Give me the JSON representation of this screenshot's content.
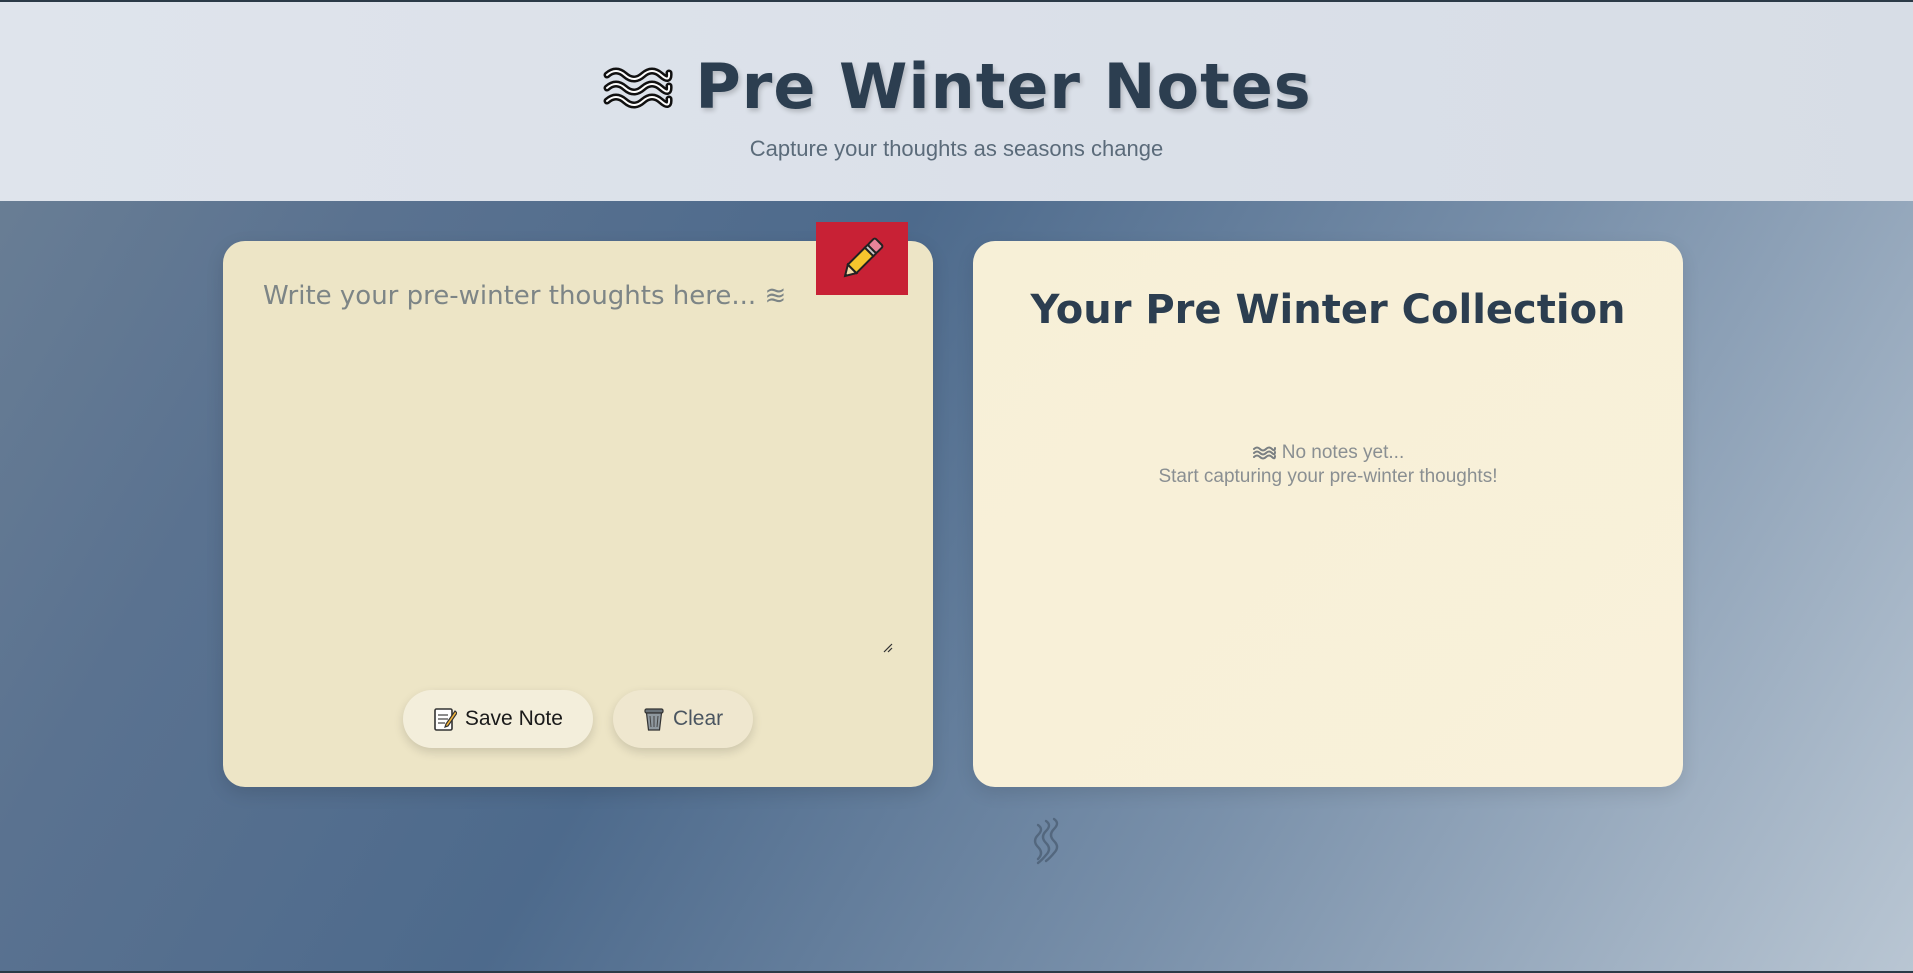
{
  "header": {
    "title": "Pre Winter Notes",
    "subtitle": "Capture your thoughts as seasons change",
    "title_icon": "wave-icon"
  },
  "editor": {
    "placeholder": "Write your pre-winter thoughts here... ≋",
    "value": "",
    "badge_icon": "pencil-icon",
    "save_label": "Save Note",
    "save_icon": "memo-icon",
    "clear_label": "Clear",
    "clear_icon": "trash-icon"
  },
  "collection": {
    "title": "Your Pre Winter Collection",
    "empty_line1": "No notes yet...",
    "empty_line2": "Start capturing your pre-winter thoughts!",
    "empty_icon": "wave-icon"
  },
  "decoration": {
    "icon": "wind-icon"
  },
  "colors": {
    "title": "#2c3e50",
    "header_bg": "#dfe4ec",
    "editor_bg": "#ede5c6",
    "collection_bg": "#f8f1d9",
    "badge_red": "#c82135",
    "page_gradient_start": "#6d8196",
    "page_gradient_end": "#b9c6d3"
  }
}
